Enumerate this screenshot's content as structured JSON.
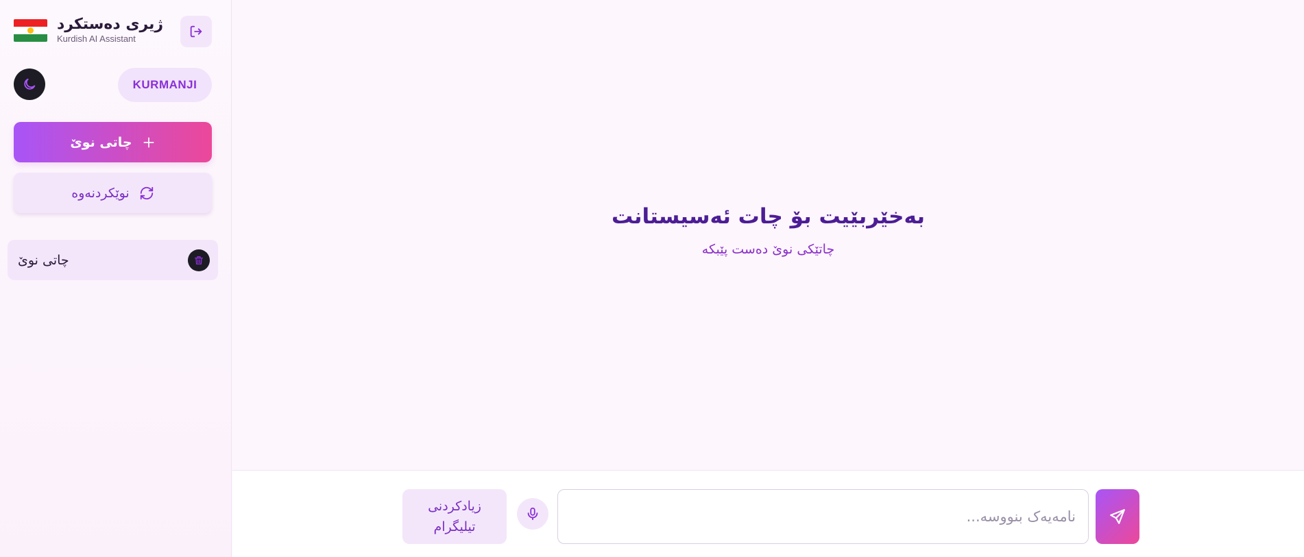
{
  "brand": {
    "title": "ژیری دەستکرد",
    "subtitle": "Kurdish AI Assistant"
  },
  "icons": {
    "logout": "logout-icon",
    "theme": "moon-icon",
    "new_chat": "plus-icon",
    "refresh": "refresh-icon",
    "delete": "trash-icon",
    "mic": "microphone-icon",
    "send": "send-icon"
  },
  "sidebar": {
    "language_label": "KURMANJI",
    "new_chat_label": "چاتی نوێ",
    "refresh_label": "نوێکردنەوە",
    "chats": [
      {
        "label": "چاتی نوێ"
      }
    ]
  },
  "main": {
    "welcome_title": "بەخێربێیت بۆ چات ئەسیستانت",
    "welcome_subtitle": "چاتێکی نوێ دەست پێبکە"
  },
  "composer": {
    "telegram_label": "زیادکردنی تیلیگرام",
    "placeholder": "نامەیەک بنووسە..."
  },
  "colors": {
    "accent_start": "#a855f7",
    "accent_end": "#ec4899",
    "soft_purple": "#f3e6fa",
    "dark": "#1d1b24"
  }
}
